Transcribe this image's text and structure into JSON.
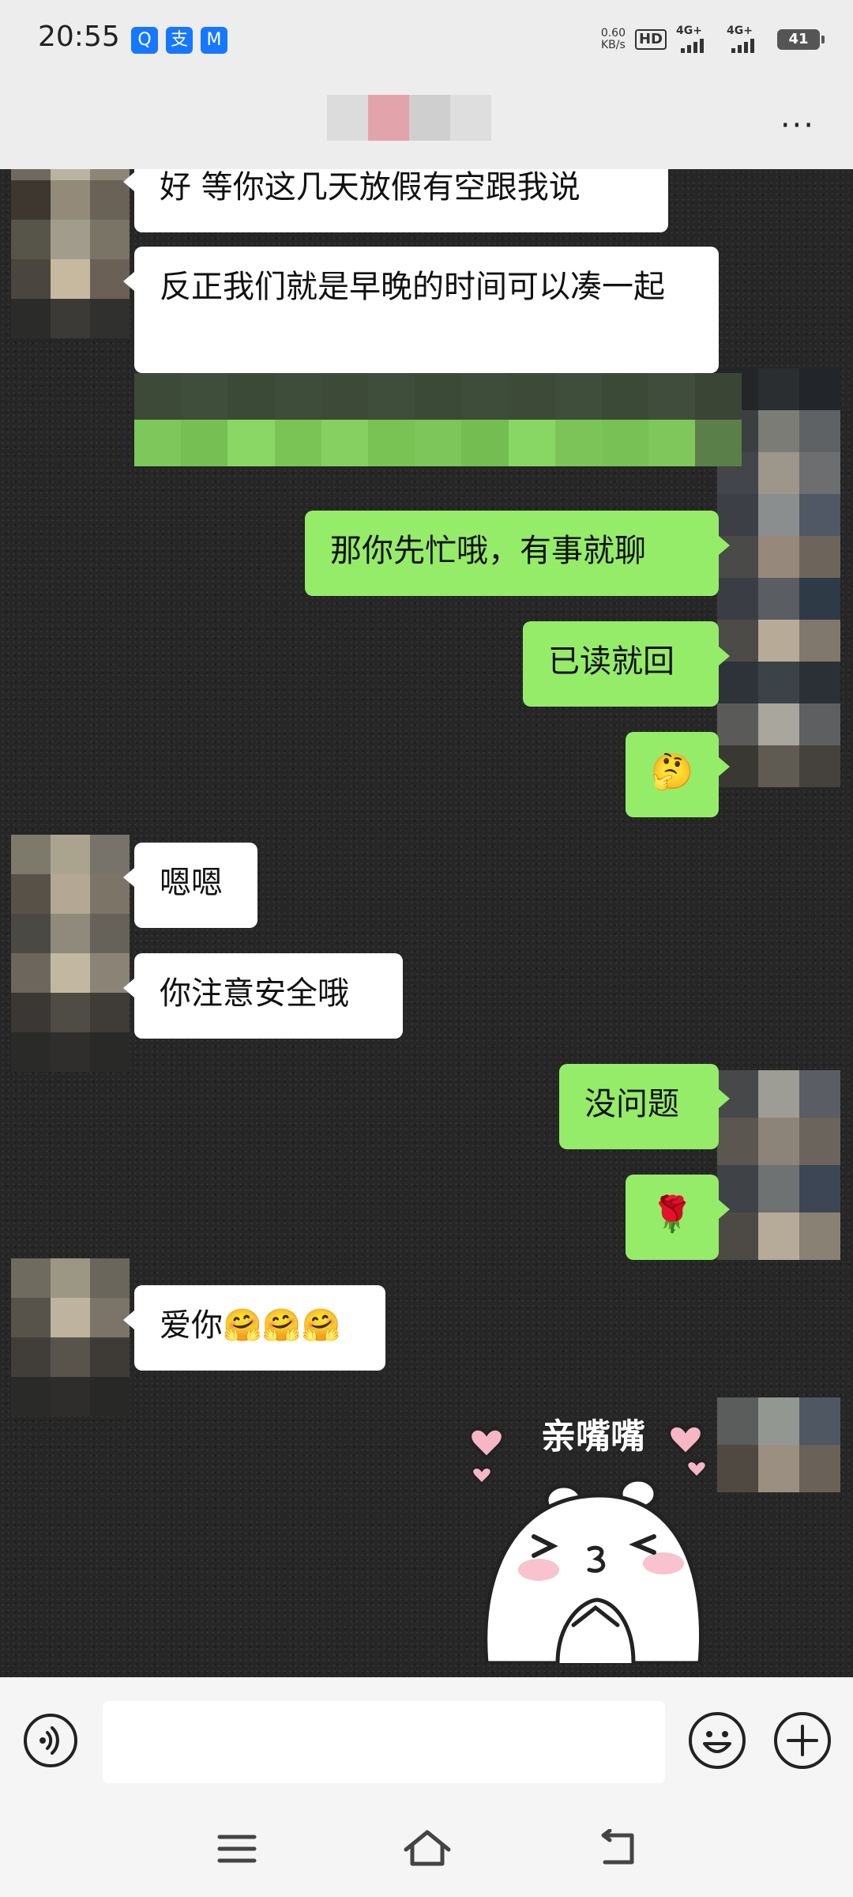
{
  "status_bar": {
    "time": "20:55",
    "apps": [
      "qq-browser-icon",
      "alipay-icon",
      "mail-app-icon"
    ],
    "net_speed_value": "0.60",
    "net_speed_unit": "KB/s",
    "hd_label": "HD",
    "sim1_label": "4G+",
    "sim2_label": "4G+",
    "battery": "41"
  },
  "nav": {
    "more_label": "···"
  },
  "messages": [
    {
      "side": "in",
      "text": "好 等你这几天放假有空跟我说"
    },
    {
      "side": "in",
      "text": "反正我们就是早晚的时间可以凑一起"
    },
    {
      "side": "out",
      "text": "那你先忙哦，有事就聊"
    },
    {
      "side": "out",
      "text": "已读就回"
    },
    {
      "side": "out",
      "text": "🤔"
    },
    {
      "side": "in",
      "text": "嗯嗯"
    },
    {
      "side": "in",
      "text": "你注意安全哦"
    },
    {
      "side": "out",
      "text": "没问题"
    },
    {
      "side": "out",
      "text": "🌹"
    },
    {
      "side": "in",
      "text": "爱你🤗🤗🤗"
    }
  ],
  "sticker": {
    "caption": "亲嘴嘴"
  },
  "colors": {
    "outgoing_bubble": "#95ec69",
    "incoming_bubble": "#ffffff",
    "background": "#262626"
  }
}
